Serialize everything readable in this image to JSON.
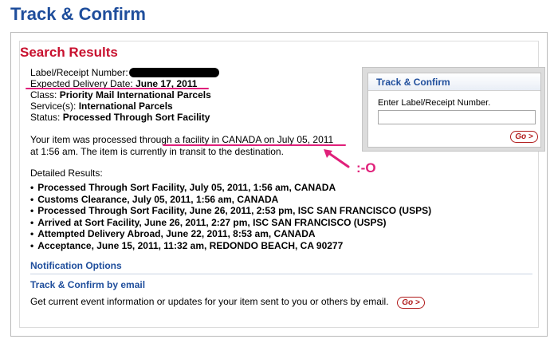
{
  "page": {
    "title": "Track & Confirm"
  },
  "results": {
    "heading": "Search Results",
    "label_prefix": "Label/Receipt Number:",
    "expected_label": "Expected Delivery Date:",
    "expected_value": "June 17, 2011",
    "class_label": "Class:",
    "class_value": "Priority Mail International Parcels",
    "services_label": "Service(s):",
    "services_value": "International Parcels",
    "status_label": "Status:",
    "status_value": "Processed Through Sort Facility",
    "summary_line1": "Your item was processed through a facility in CANADA on July 05, 2011",
    "summary_line2": "at 1:56 am. The item is currently in transit to the destination.",
    "detailed_label": "Detailed Results:",
    "events": [
      "Processed Through Sort Facility, July 05, 2011, 1:56 am, CANADA",
      "Customs Clearance, July 05, 2011, 1:56 am, CANADA",
      "Processed Through Sort Facility, June 26, 2011, 2:53 pm, ISC SAN FRANCISCO (USPS)",
      "Arrived at Sort Facility, June 26, 2011, 2:27 pm, ISC SAN FRANCISCO (USPS)",
      "Attempted Delivery Abroad, June 22, 2011, 8:53 am, CANADA",
      "Acceptance, June 15, 2011, 11:32 am, REDONDO BEACH, CA 90277"
    ]
  },
  "notification": {
    "title": "Notification Options",
    "email_title": "Track & Confirm by email",
    "email_desc": "Get current event information or updates for your item sent to you or others by email.",
    "go_label": "Go >"
  },
  "side_panel": {
    "title": "Track & Confirm",
    "input_label": "Enter Label/Receipt Number.",
    "input_value": "",
    "go_label": "Go >"
  },
  "annotation": {
    "reaction": ":-O",
    "color": "#e0207a"
  }
}
